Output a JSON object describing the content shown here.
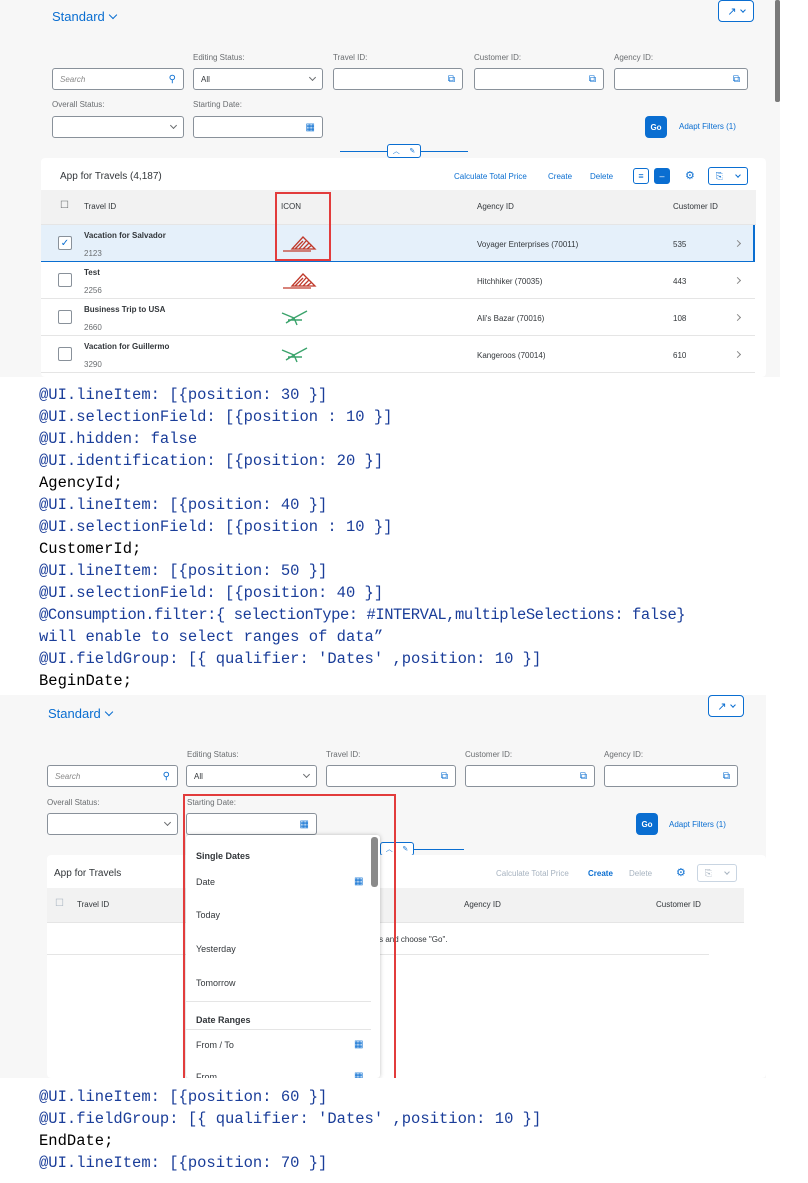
{
  "shot1": {
    "variant": "Standard",
    "filters": {
      "search_placeholder": "Search",
      "editing_status_label": "Editing Status:",
      "editing_status_value": "All",
      "travel_id_label": "Travel ID:",
      "customer_id_label": "Customer ID:",
      "agency_id_label": "Agency ID:",
      "overall_status_label": "Overall Status:",
      "starting_date_label": "Starting Date:",
      "go": "Go",
      "adapt_filters": "Adapt Filters (1)"
    },
    "table": {
      "title": "App for Travels (4,187)",
      "actions": [
        "Calculate Total Price",
        "Create",
        "Delete"
      ],
      "columns": [
        "Travel ID",
        "ICON",
        "Agency ID",
        "Customer ID"
      ],
      "rows": [
        {
          "name": "Vacation for Salvador",
          "id": "2123",
          "icon": "red-triangle-icon",
          "agency": "Voyager Enterprises (70011)",
          "customer": "535",
          "selected": true
        },
        {
          "name": "Test",
          "id": "2256",
          "icon": "red-triangle-icon",
          "agency": "Hitchhiker (70035)",
          "customer": "443",
          "selected": false
        },
        {
          "name": "Business Trip to USA",
          "id": "2660",
          "icon": "green-plane-icon",
          "agency": "Ali's Bazar (70016)",
          "customer": "108",
          "selected": false
        },
        {
          "name": "Vacation for Guillermo",
          "id": "3290",
          "icon": "green-plane-icon",
          "agency": "Kangeroos (70014)",
          "customer": "610",
          "selected": false
        }
      ]
    }
  },
  "code1": [
    "@UI.lineItem: [{position: 30 }]",
    "@UI.selectionField: [{position : 10 }]",
    "@UI.hidden: false",
    "@UI.identification: [{position: 20 }]",
    "AgencyId;",
    "@UI.lineItem: [{position: 40 }]",
    "@UI.selectionField: [{position : 10 }]",
    "CustomerId;",
    "@UI.lineItem: [{position: 50 }]",
    "@UI.selectionField: [{position: 40 }]",
    "@Consumption.filter:{ selectionType: #INTERVAL,multipleSelections: false}",
    "will enable to select ranges of data”",
    "@UI.fieldGroup: [{ qualifier: 'Dates' ,position: 10 }]",
    "BeginDate;"
  ],
  "shot2": {
    "variant": "Standard",
    "filters": {
      "search_placeholder": "Search",
      "editing_status_label": "Editing Status:",
      "editing_status_value": "All",
      "travel_id_label": "Travel ID:",
      "customer_id_label": "Customer ID:",
      "agency_id_label": "Agency ID:",
      "overall_status_label": "Overall Status:",
      "starting_date_label": "Starting Date:",
      "go": "Go",
      "adapt_filters": "Adapt Filters (1)"
    },
    "table": {
      "title": "App for Travels",
      "actions": [
        "Calculate Total Price",
        "Create",
        "Delete"
      ],
      "columns": [
        "Travel ID",
        "Agency ID",
        "Customer ID"
      ],
      "empty_text": "filters and choose \"Go\"."
    },
    "date_popover": {
      "single_dates_header": "Single Dates",
      "items1": [
        "Date",
        "Today",
        "Yesterday",
        "Tomorrow"
      ],
      "date_ranges_header": "Date Ranges",
      "items2": [
        "From / To",
        "From"
      ]
    }
  },
  "code2": [
    "@UI.lineItem: [{position: 60 }]",
    "@UI.fieldGroup: [{ qualifier: 'Dates' ,position: 10 }]",
    "EndDate;",
    "@UI.lineItem: [{position: 70 }]"
  ],
  "colors": {
    "accent": "#0a6ed1",
    "highlight": "#e23c3c",
    "code": "#1a3d99"
  }
}
